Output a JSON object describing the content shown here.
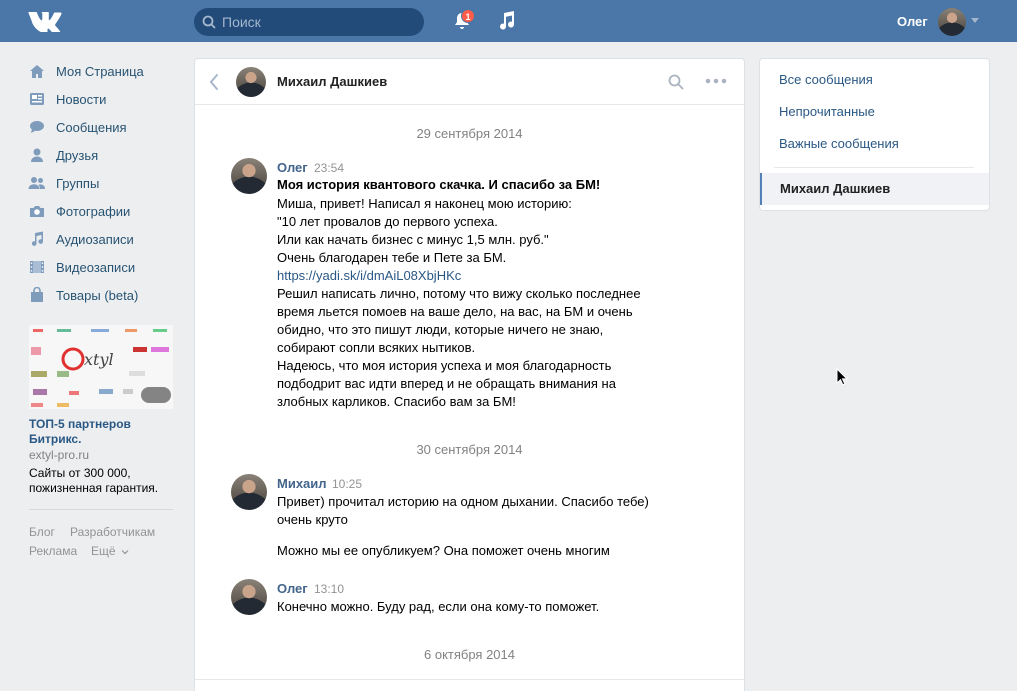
{
  "header": {
    "search_placeholder": "Поиск",
    "notifications_count": "1",
    "user_name": "Олег"
  },
  "nav": [
    {
      "label": "Моя Страница",
      "icon": "home-icon"
    },
    {
      "label": "Новости",
      "icon": "news-icon"
    },
    {
      "label": "Сообщения",
      "icon": "messages-icon"
    },
    {
      "label": "Друзья",
      "icon": "friends-icon"
    },
    {
      "label": "Группы",
      "icon": "groups-icon"
    },
    {
      "label": "Фотографии",
      "icon": "camera-icon"
    },
    {
      "label": "Аудиозаписи",
      "icon": "music-icon"
    },
    {
      "label": "Видеозаписи",
      "icon": "video-icon"
    },
    {
      "label": "Товары (beta)",
      "icon": "bag-icon"
    }
  ],
  "ad": {
    "title": "ТОП-5 партнеров Битрикс.",
    "domain": "extyl-pro.ru",
    "text": "Сайты от 300 000, пожизненная гарантия."
  },
  "footer": {
    "blog": "Блог",
    "developers": "Разработчикам",
    "ads": "Реклама",
    "more": "Ещё"
  },
  "chat": {
    "contact_name": "Михаил Дашкиев",
    "dates": [
      "29 сентября 2014",
      "30 сентября 2014",
      "6 октября 2014"
    ],
    "messages": [
      {
        "sender": "Олег",
        "time": "23:54",
        "lines": [
          "Моя история квантового скачка. И спасибо за БМ!",
          "Миша, привет! Написал я наконец мою историю:",
          "\"10 лет провалов до первого успеха.",
          "Или как начать бизнес с минус 1,5 млн. руб.\"",
          "Очень благодарен тебе и Пете за БМ.",
          "https://yadi.sk/i/dmAiL08XbjHKc",
          "Решил написать лично, потому что вижу сколько последнее",
          "время льется помоев на ваше дело, на вас, на БМ и очень",
          "обидно, что это пишут люди, которые ничего не знаю,",
          "собирают сопли всяких нытиков.",
          "Надеюсь, что моя история успеха и моя благодарность",
          "подбодрит вас идти вперед и не обращать внимания на",
          "злобных карликов. Спасибо вам за БМ!"
        ]
      },
      {
        "sender": "Михаил",
        "time": "10:25",
        "lines": [
          "Привет) прочитал историю на одном дыхании. Спасибо тебе)",
          "очень круто",
          "Можно мы ее опубликуем? Она поможет очень многим"
        ]
      },
      {
        "sender": "Олег",
        "time": "13:10",
        "lines": [
          "Конечно можно. Буду рад, если она кому-то поможет."
        ]
      }
    ]
  },
  "right_panel": {
    "all": "Все сообщения",
    "unread": "Непрочитанные",
    "important": "Важные сообщения",
    "active_chat": "Михаил Дашкиев"
  },
  "colors": {
    "header_bg": "#4a76a8",
    "link": "#2a5885",
    "sender": "#42648b",
    "page_bg": "#edeef0"
  }
}
